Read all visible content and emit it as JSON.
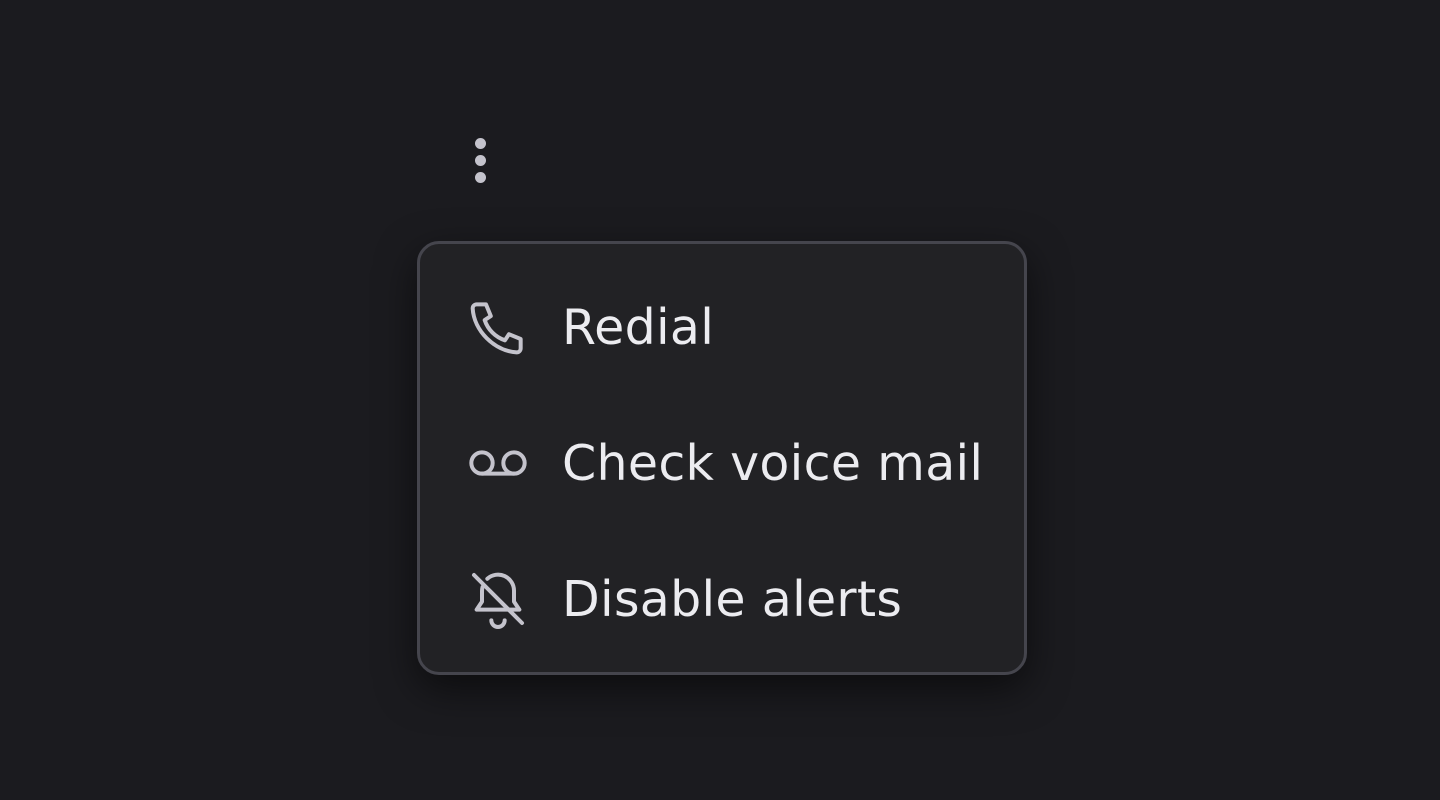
{
  "trigger": {
    "icon": "more-vertical-icon"
  },
  "menu": {
    "items": [
      {
        "label": "Redial",
        "icon": "phone-icon"
      },
      {
        "label": "Check voice mail",
        "icon": "voicemail-icon"
      },
      {
        "label": "Disable alerts",
        "icon": "bell-off-icon"
      }
    ]
  },
  "colors": {
    "background": "#1b1b1f",
    "menu_background": "#222225",
    "menu_border": "#45454d",
    "text": "#ececf0",
    "icon": "#c4c3cc"
  }
}
